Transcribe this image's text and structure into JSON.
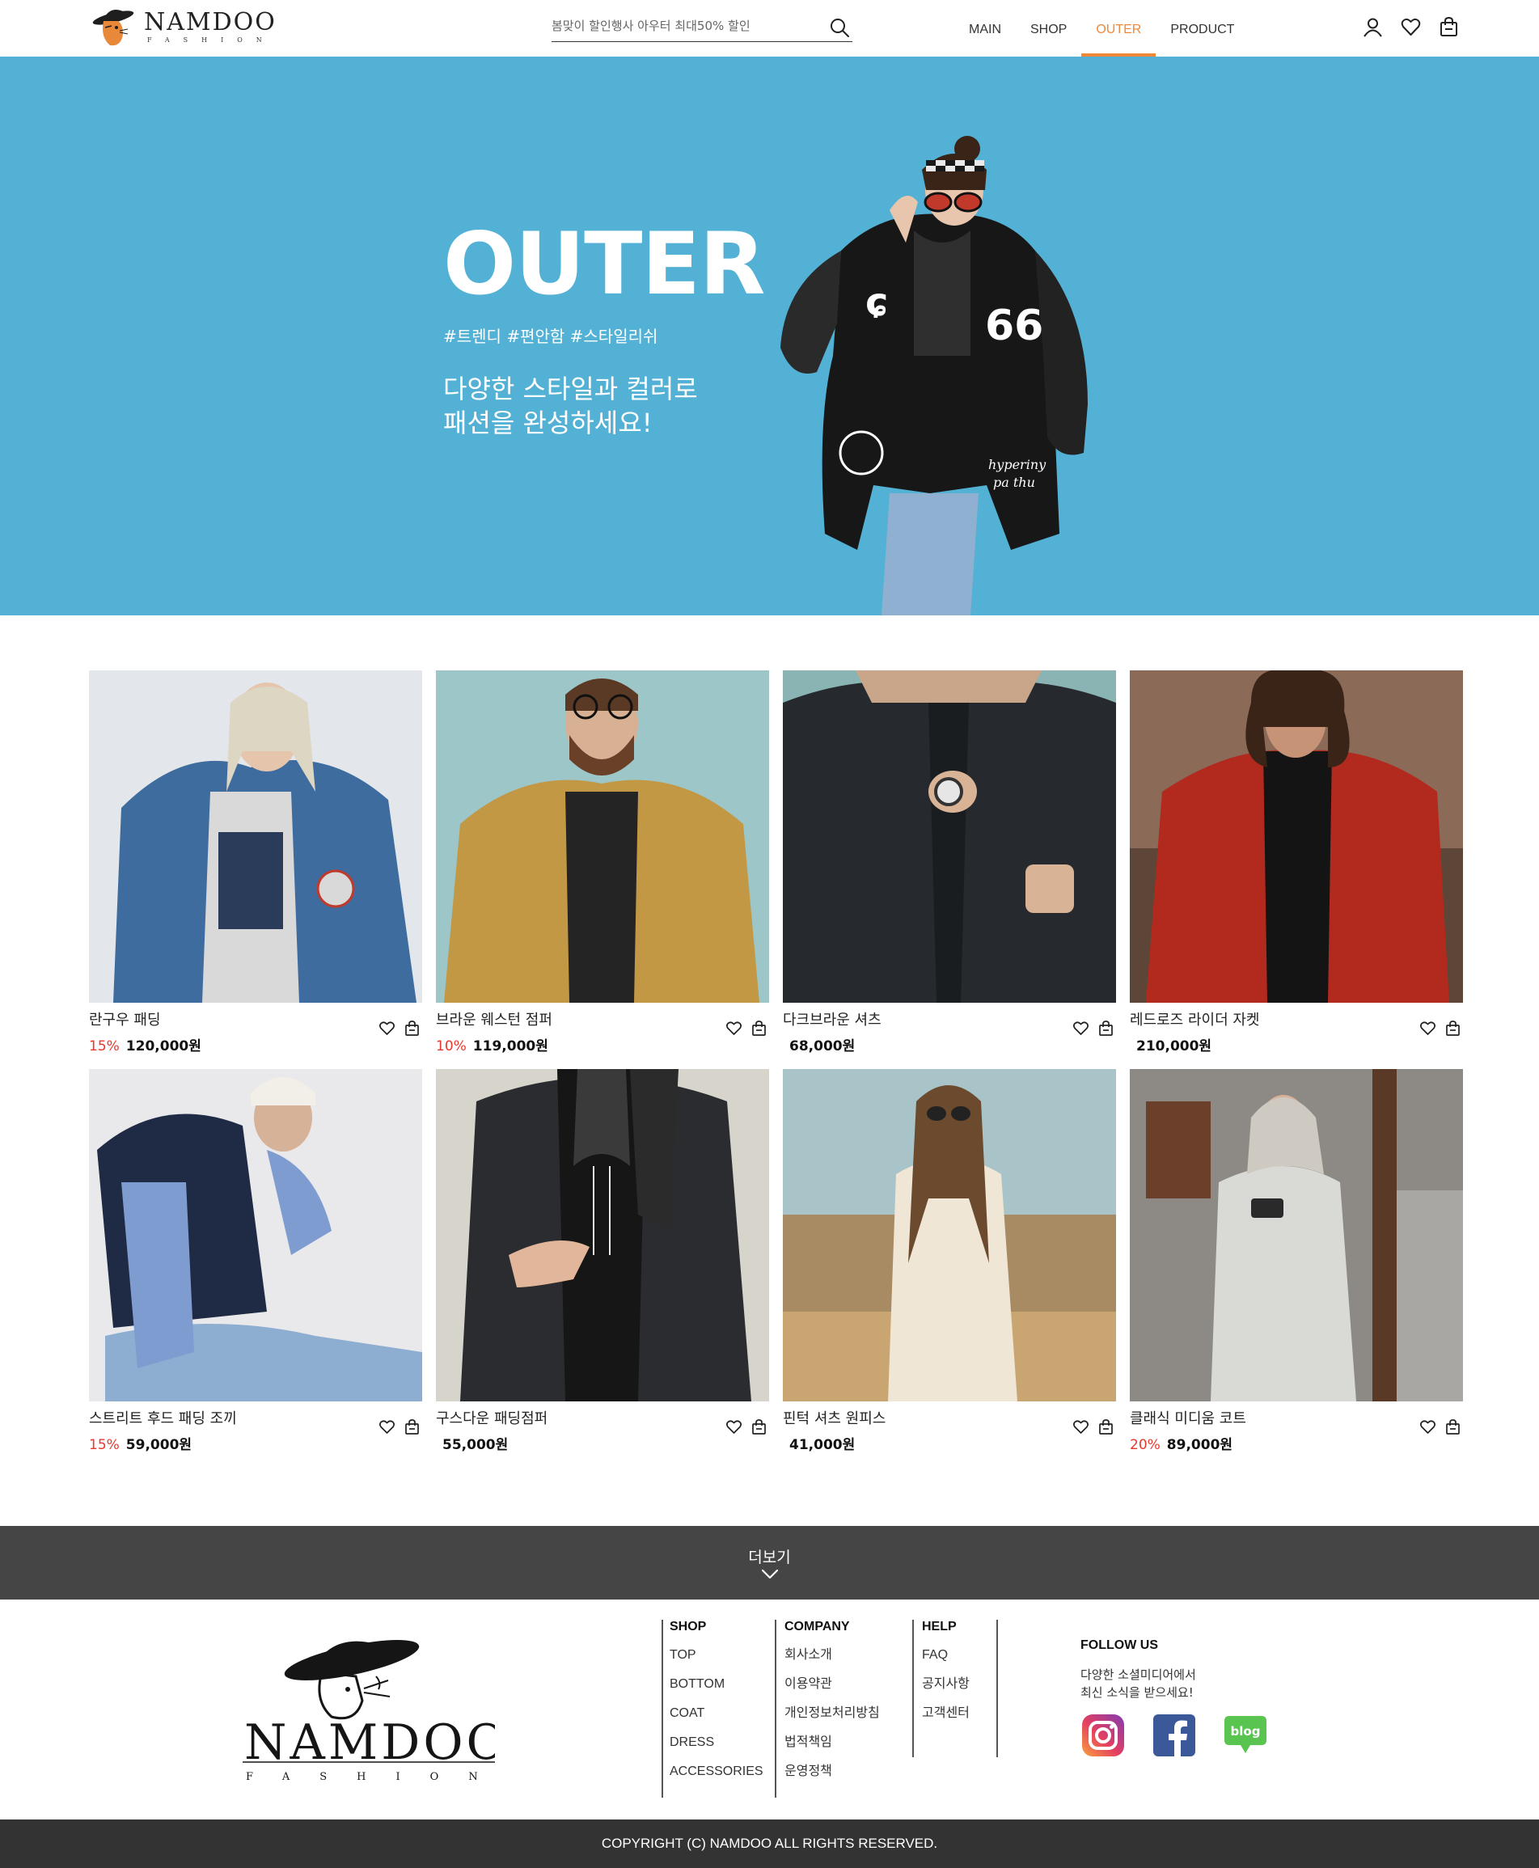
{
  "brand": {
    "name": "NAMDOO",
    "sub": "FASHION"
  },
  "search": {
    "placeholder": "봄맞이 할인행사 아우터 최대50% 할인"
  },
  "nav": [
    {
      "label": "MAIN",
      "active": false
    },
    {
      "label": "SHOP",
      "active": false
    },
    {
      "label": "OUTER",
      "active": true
    },
    {
      "label": "PRODUCT",
      "active": false
    }
  ],
  "header_icons": [
    "user-icon",
    "heart-icon",
    "shopping-bag-icon"
  ],
  "hero": {
    "title": "OUTER",
    "tags": "#트렌디 #편안함 #스타일리쉬",
    "copy_line1": "다양한 스타일과 컬러로",
    "copy_line2": "패션을 완성하세요!",
    "background": "#52b1d4"
  },
  "products": [
    {
      "name": "란구우 패딩",
      "discount": "15%",
      "price": "120,000원"
    },
    {
      "name": "브라운 웨스턴 점퍼",
      "discount": "10%",
      "price": "119,000원"
    },
    {
      "name": "다크브라운 셔츠",
      "discount": "",
      "price": "68,000원"
    },
    {
      "name": "레드로즈 라이더 자켓",
      "discount": "",
      "price": "210,000원"
    },
    {
      "name": "스트리트 후드 패딩 조끼",
      "discount": "15%",
      "price": "59,000원"
    },
    {
      "name": "구스다운 패딩점퍼",
      "discount": "",
      "price": "55,000원"
    },
    {
      "name": "핀턱 셔츠 원피스",
      "discount": "",
      "price": "41,000원"
    },
    {
      "name": "클래식 미디움 코트",
      "discount": "20%",
      "price": "89,000원"
    }
  ],
  "more": {
    "label": "더보기"
  },
  "footer": {
    "columns": [
      {
        "title": "SHOP",
        "items": [
          "TOP",
          "BOTTOM",
          "COAT",
          "DRESS",
          "ACCESSORIES"
        ]
      },
      {
        "title": "COMPANY",
        "items": [
          "회사소개",
          "이용약관",
          "개인정보처리방침",
          "법적책임",
          "운영정책"
        ]
      },
      {
        "title": "HELP",
        "items": [
          "FAQ",
          "공지사항",
          "고객센터"
        ]
      }
    ],
    "follow": {
      "title": "FOLLOW US",
      "desc_line1": "다양한 소셜미디어에서",
      "desc_line2": "최신 소식을 받으세요!",
      "blog_label": "blog"
    },
    "copyright": "COPYRIGHT (C) NAMDOO ALL RIGHTS RESERVED."
  },
  "colors": {
    "accent": "#f0883a",
    "discount": "#e8372c",
    "more_bar": "#454545",
    "copyright_bar": "#333333"
  }
}
